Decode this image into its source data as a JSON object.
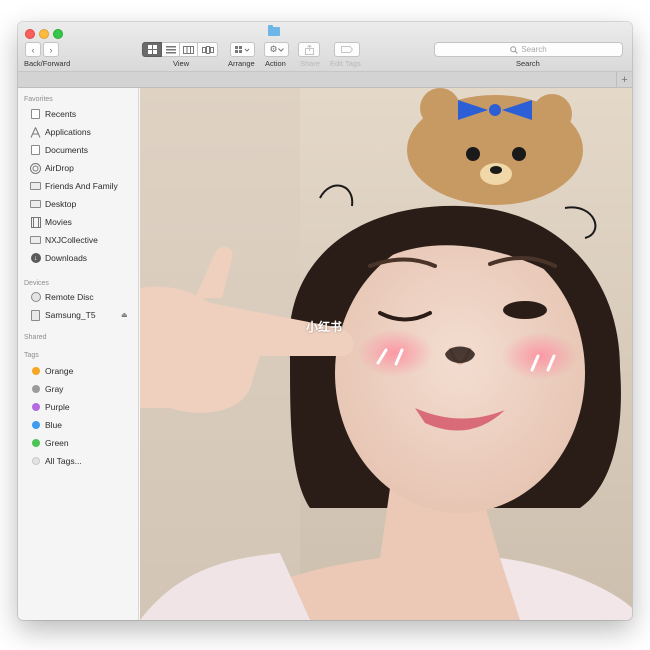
{
  "toolbar": {
    "back_forward_label": "Back/Forward",
    "back_glyph": "‹",
    "forward_glyph": "›",
    "view_label": "View",
    "arrange_label": "Arrange",
    "action_label": "Action",
    "share_label": "Share",
    "edit_tags_label": "Edit Tags",
    "search_label": "Search",
    "search_placeholder": "Search",
    "view_modes": [
      "icon-view",
      "list-view",
      "column-view",
      "cover-flow-view"
    ],
    "active_view": "icon-view"
  },
  "tabbar": {
    "add_glyph": "+"
  },
  "sidebar": {
    "favorites_heading": "Favorites",
    "favorites": [
      {
        "label": "Recents",
        "icon": "recents-icon"
      },
      {
        "label": "Applications",
        "icon": "applications-icon"
      },
      {
        "label": "Documents",
        "icon": "documents-icon"
      },
      {
        "label": "AirDrop",
        "icon": "airdrop-icon"
      },
      {
        "label": "Friends And Family",
        "icon": "folder-icon"
      },
      {
        "label": "Desktop",
        "icon": "desktop-icon"
      },
      {
        "label": "Movies",
        "icon": "movies-icon"
      },
      {
        "label": "NXJCollective",
        "icon": "folder-icon"
      },
      {
        "label": "Downloads",
        "icon": "downloads-icon"
      }
    ],
    "devices_heading": "Devices",
    "devices": [
      {
        "label": "Remote Disc",
        "icon": "disc-icon"
      },
      {
        "label": "Samsung_T5",
        "icon": "drive-icon",
        "eject": "⏏"
      }
    ],
    "shared_heading": "Shared",
    "tags_heading": "Tags",
    "tags": [
      {
        "label": "Orange",
        "color": "#f5a623"
      },
      {
        "label": "Gray",
        "color": "#9b9b9b"
      },
      {
        "label": "Purple",
        "color": "#b36ae2"
      },
      {
        "label": "Blue",
        "color": "#3b9cf0"
      },
      {
        "label": "Green",
        "color": "#4cc552"
      },
      {
        "label": "All Tags...",
        "color": "#e3e3e3"
      }
    ]
  },
  "photo": {
    "watermark": "小红书"
  }
}
